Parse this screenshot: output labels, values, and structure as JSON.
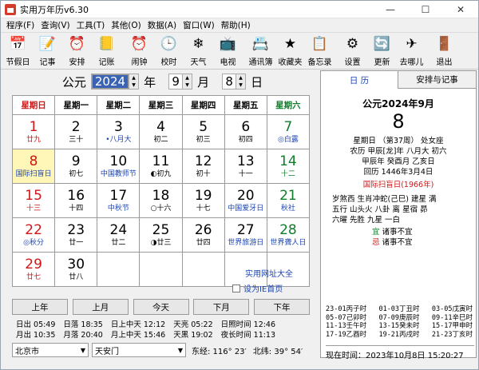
{
  "title": "实用万年历v6.30",
  "menu": [
    "程序(F)",
    "查询(V)",
    "工具(T)",
    "其他(O)",
    "数据(A)",
    "窗口(W)",
    "帮助(H)"
  ],
  "toolbar": [
    {
      "label": "节假日",
      "icon": "holiday-icon"
    },
    {
      "label": "记事",
      "icon": "notes-icon"
    },
    {
      "label": "安排",
      "icon": "schedule-icon"
    },
    {
      "label": "记账",
      "icon": "ledger-icon"
    },
    {
      "label": "闹钟",
      "icon": "alarm-clock-icon"
    },
    {
      "label": "校时",
      "icon": "time-sync-icon"
    },
    {
      "label": "天气",
      "icon": "weather-icon"
    },
    {
      "label": "电视",
      "icon": "tv-icon"
    },
    {
      "label": "通讯簿",
      "icon": "address-book-icon"
    },
    {
      "label": "收藏夹",
      "icon": "favorites-icon"
    },
    {
      "label": "备忘录",
      "icon": "memo-icon"
    },
    {
      "label": "设置",
      "icon": "settings-icon"
    },
    {
      "label": "更新",
      "icon": "update-icon"
    },
    {
      "label": "去哪儿",
      "icon": "travel-icon"
    },
    {
      "label": "退出",
      "icon": "exit-icon"
    }
  ],
  "datebar": {
    "prefix": "公元",
    "year": "2024",
    "year_unit": "年",
    "month": "9",
    "month_unit": "月",
    "day": "8",
    "day_unit": "日"
  },
  "weekdays": [
    "星期日",
    "星期一",
    "星期二",
    "星期三",
    "星期四",
    "星期五",
    "星期六"
  ],
  "weeks": [
    [
      {
        "d": "1",
        "l": "廿九"
      },
      {
        "d": "2",
        "l": "三十"
      },
      {
        "d": "3",
        "l": "•八月大",
        "lc": "blu"
      },
      {
        "d": "4",
        "l": "初二"
      },
      {
        "d": "5",
        "l": "初三"
      },
      {
        "d": "6",
        "l": "初四"
      },
      {
        "d": "7",
        "l": "◎白露",
        "lc": "blu"
      }
    ],
    [
      {
        "d": "8",
        "l": "国际扫盲日",
        "lc": "blu",
        "today": true
      },
      {
        "d": "9",
        "l": "初七"
      },
      {
        "d": "10",
        "l": "中国教师节",
        "lc": "blu"
      },
      {
        "d": "11",
        "l": "◐初九"
      },
      {
        "d": "12",
        "l": "初十"
      },
      {
        "d": "13",
        "l": "十一"
      },
      {
        "d": "14",
        "l": "十二"
      }
    ],
    [
      {
        "d": "15",
        "l": "十三"
      },
      {
        "d": "16",
        "l": "十四"
      },
      {
        "d": "17",
        "l": "中秋节",
        "lc": "blu"
      },
      {
        "d": "18",
        "l": "○十六"
      },
      {
        "d": "19",
        "l": "十七"
      },
      {
        "d": "20",
        "l": "中国爱牙日",
        "lc": "blu"
      },
      {
        "d": "21",
        "l": "秋社",
        "lc": "blu"
      }
    ],
    [
      {
        "d": "22",
        "l": "◎秋分",
        "lc": "blu"
      },
      {
        "d": "23",
        "l": "廿一"
      },
      {
        "d": "24",
        "l": "廿二"
      },
      {
        "d": "25",
        "l": "◑廿三"
      },
      {
        "d": "26",
        "l": "廿四"
      },
      {
        "d": "27",
        "l": "世界旅游日",
        "lc": "blu"
      },
      {
        "d": "28",
        "l": "世界聋人日",
        "lc": "blu"
      }
    ],
    [
      {
        "d": "29",
        "l": "廿七"
      },
      {
        "d": "30",
        "l": "廿八"
      },
      {
        "d": "",
        "l": ""
      },
      {
        "d": "",
        "l": ""
      },
      {
        "d": "",
        "l": ""
      },
      {
        "d": "",
        "l": ""
      },
      {
        "d": "",
        "l": ""
      }
    ]
  ],
  "web": {
    "link": "实用网址大全",
    "checkbox": "设为IE首页"
  },
  "nav": [
    "上年",
    "上月",
    "今天",
    "下月",
    "下年"
  ],
  "sun": [
    [
      "日出 05:49",
      "日落 18:35",
      "日上中天 12:12",
      "天亮 05:22",
      "日照时间 12:46"
    ],
    [
      "月出 10:35",
      "月落 20:40",
      "月上中天 15:46",
      "天黑 19:02",
      "夜长时间 11:13"
    ]
  ],
  "location": {
    "city": "北京市",
    "place": "天安门",
    "lng": "东经:  116° 23′",
    "lat": "北纬:  39° 54′"
  },
  "tabs": [
    "日  历",
    "安排与记事"
  ],
  "detail": {
    "header": "公元2024年9月",
    "day": "8",
    "lines": [
      "星期日  （第37周）  处女座",
      "农历  甲辰[龙]年  八月大  初六",
      "甲辰年  癸酉月  乙亥日",
      "回历  1446年3月4日"
    ],
    "festival": "国际扫盲日(1966年)",
    "info": [
      "岁煞西 生肖冲蛇(己巳)  建星 满",
      "五行 山头火  八卦 离  星宿 昴",
      "六曜 先胜  九星 一白"
    ],
    "yi": "宜",
    "yi_text": "诸事不宜",
    "ji": "忌",
    "ji_text": "诸事不宜"
  },
  "hours": [
    [
      "23-01丙子时",
      "01-03丁丑时",
      "03-05戊寅时"
    ],
    [
      "05-07己卯时",
      "07-09庚辰时",
      "09-11辛巳时"
    ],
    [
      "11-13壬午时",
      "13-15癸未时",
      "15-17甲申时"
    ],
    [
      "17-19乙酉时",
      "19-21丙戌时",
      "21-23丁亥时"
    ]
  ],
  "clock": "现在时间：2023年10月8日  15:20:27"
}
